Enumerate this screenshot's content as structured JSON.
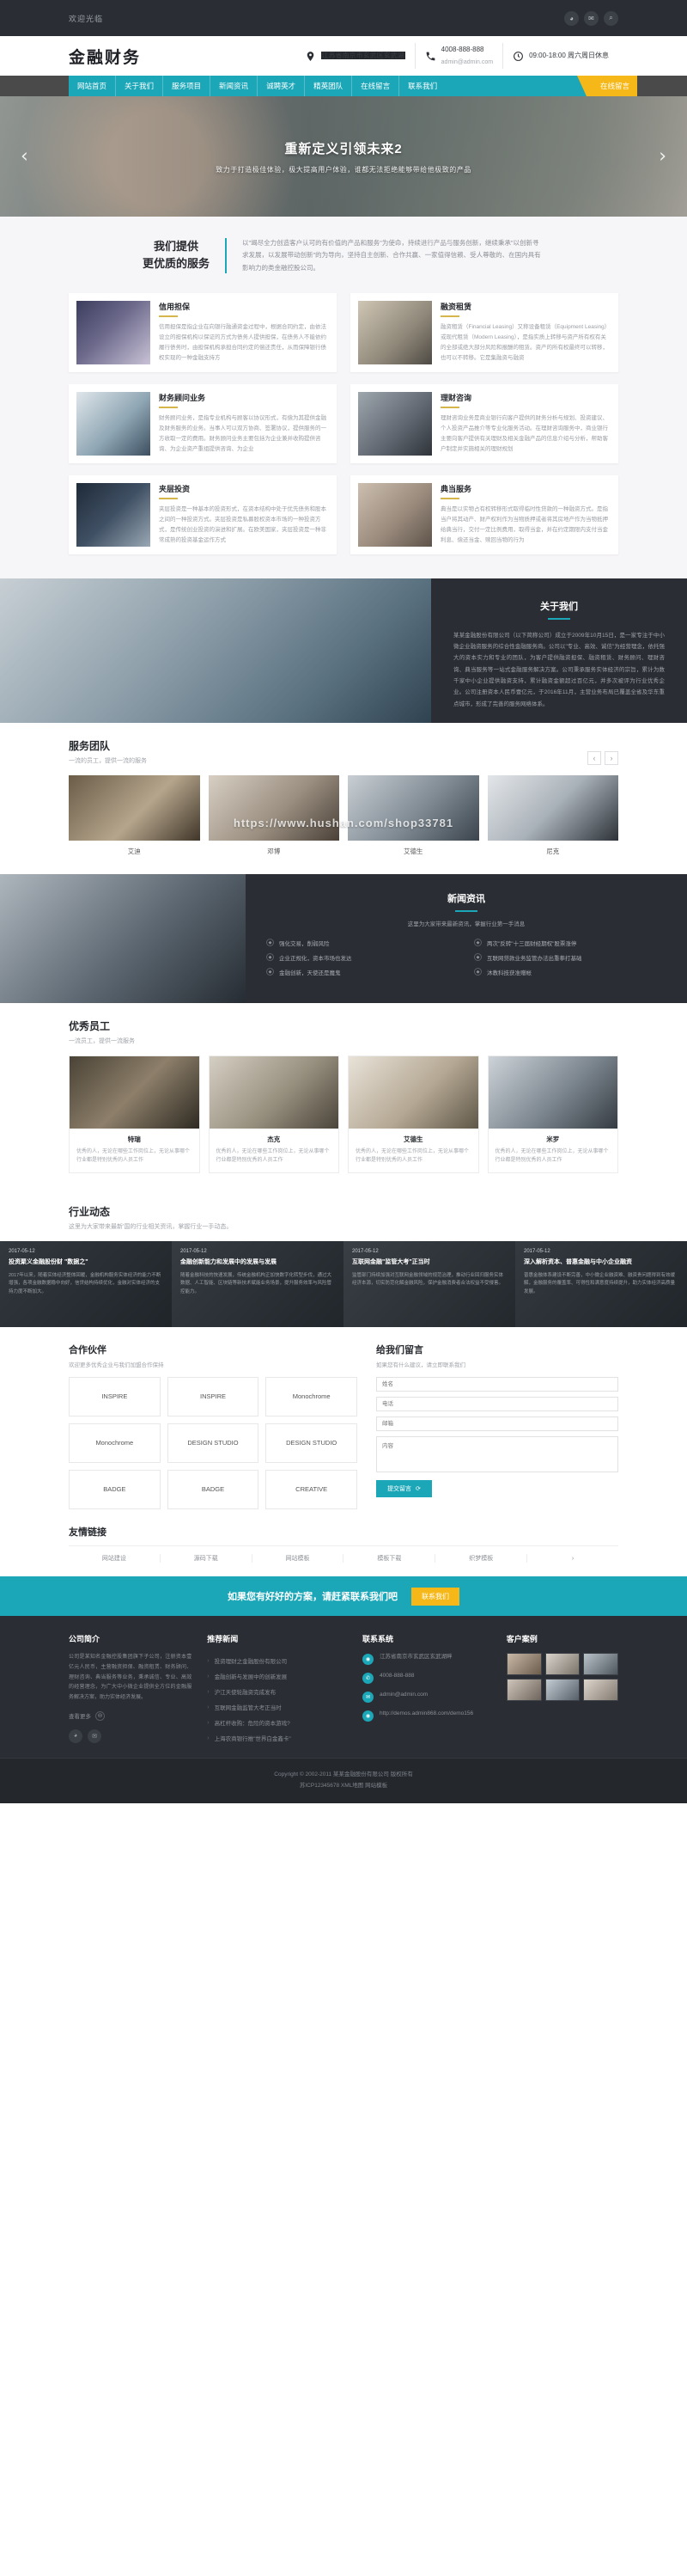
{
  "topbar": {
    "welcome": "欢迎光临",
    "social": [
      {
        "name": "weibo-icon",
        "glyph": "◕"
      },
      {
        "name": "wechat-icon",
        "glyph": "✉"
      },
      {
        "name": "search-icon",
        "glyph": "⌕"
      }
    ]
  },
  "header": {
    "logo": "金融财务",
    "info": [
      {
        "icon": "location-icon",
        "line1": "江苏省南京市玄武区玄武湖",
        "line1_hl": "江苏省南京市玄武区玄",
        "line1_rest": "武湖",
        "line2": ""
      },
      {
        "icon": "phone-icon",
        "line1": "4008-888-888",
        "line2": "admin@admin.com"
      },
      {
        "icon": "clock-icon",
        "line1": "09:00-18:00 周六周日休息",
        "line2": ""
      }
    ]
  },
  "nav": {
    "items": [
      "网站首页",
      "关于我们",
      "服务项目",
      "新闻资讯",
      "诚聘英才",
      "精英团队",
      "在线留言",
      "联系我们"
    ],
    "cta": "在线留言"
  },
  "banner": {
    "title": "重新定义引领未来2",
    "subtitle": "致力于打造极佳体验，极大提高用户体验，谁都无法拒绝能够带给他极致的产品",
    "prev": "‹",
    "next": "›"
  },
  "services": {
    "title_line1": "我们提供",
    "title_line2": "更优质的服务",
    "desc": "以\"竭尽全力创造客户认可的有价值的产品和服务\"为使命，持续进行产品与服务创新，继续秉承\"以创新寻求发展，以发展带动创新\"的为导向，坚持自主创新、合作共赢、一家值得信赖、受人尊敬的、在国内具有影响力的类金融控股公司。",
    "cards": [
      {
        "title": "信用担保",
        "text": "信用担保是指企业在向银行融通资金过程中，根据合同约定，由依法设立的担保机构以保证的方式为债务人提供担保，在债务人不能依约履行债务时，由担保机构承担合同约定的偿还责任，从而保障银行债权实现的一种金融支持方"
      },
      {
        "title": "融资租赁",
        "text": "融资租赁（Financial Leasing）又称设备租赁（Equipment Leasing）或现代租赁（Modern Leasing），是指实质上转移与资产所有权有关的全部或绝大部分风险和报酬的租赁。资产的所有权最终可以转移，也可以不转移。它是集融资与融资"
      },
      {
        "title": "财务顾问业务",
        "text": "财务顾问业务，是指专业机构与顾客以协议形式，有偿为其提供金融及财务服务的业务。当事人可以双方协商、签署协议，提供服务的一方收取一定的费用。财务顾问业务主要包括为企业兼并收购提供咨询、为企业资产重组提供咨询、为企业"
      },
      {
        "title": "理财咨询",
        "text": "理财咨询业务是商业银行向客户提供的财务分析与规划、投资建议、个人投资产品推介等专业化服务活动。在理财咨询服务中，商业银行主要向客户提供有关理财及相关金融产品的信息介绍与分析，帮助客户制定并实施相关的理财规划"
      },
      {
        "title": "夹层投资",
        "text": "夹层投资是一种基本的投资形式，在资本结构中处于优先债务和股本之间的一种投资方式。夹层投资是私募股权资本市场的一种投资方式，是传统创业投资的演进和扩展。在欧美国家，夹层投资是一种非常成熟的投资基金运作方式"
      },
      {
        "title": "典当服务",
        "text": "典当是以实物占有权转移形式取得临时性贷款的一种融资方式。是指当户将其动产、财产权利作为当物质押或者将其房地产作为当物抵押给典当行，交付一定比例费用，取得当金，并在约定期限内支付当金利息、偿还当金、赎回当物的行为"
      }
    ]
  },
  "about": {
    "title": "关于我们",
    "text": "某某金融股份有限公司（以下简称公司）成立于2009年10月15日，是一家专注于中小微企业融资服务的综合性金融服务商。公司以\"专业、高效、诚信\"为经营理念，依托强大的资本实力和专业的团队，为客户提供融资担保、融资租赁、财务顾问、理财咨询、典当服务等一站式金融服务解决方案。公司秉承服务实体经济的宗旨，累计为数千家中小企业提供融资支持，累计融资金额超过百亿元，并多次被评为行业优秀企业。公司注册资本人民币壹亿元，于2016年11月，主营业务布局已覆盖全省及华东重点城市，形成了完善的服务网络体系。"
  },
  "team": {
    "title": "服务团队",
    "subtitle": "一流的员工，提供一流的服务",
    "prev": "‹",
    "next": "›",
    "members": [
      {
        "name": "艾迪"
      },
      {
        "name": "邓博"
      },
      {
        "name": "艾德生"
      },
      {
        "name": "尼克"
      }
    ],
    "watermark": "https://www.hushan.com/shop33781"
  },
  "news": {
    "title": "新闻资讯",
    "subtitle": "这里为大家带来最新资讯，掌握行业第一手消息",
    "items": [
      "强化交易，削弱风险",
      "两次\"反转\"十三届财经期权\"股票涨停",
      "企业正规化，资本市场也发达",
      "互联网贷款业务监管办法出重拳打基础",
      "金融创新，天使还是魔鬼",
      "沐教科技获准赠帐"
    ]
  },
  "staff": {
    "title": "优秀员工",
    "subtitle": "一流员工，提供一流服务",
    "members": [
      {
        "name": "特瑞",
        "desc": "优秀的人，无论在哪些工作岗位上，无论从事哪个行业都是特别优秀的人员工作"
      },
      {
        "name": "杰克",
        "desc": "优秀的人，无论在哪些工作岗位上，无论从事哪个行业都是特别优秀的人员工作"
      },
      {
        "name": "艾德生",
        "desc": "优秀的人，无论在哪些工作岗位上，无论从事哪个行业都是特别优秀的人员工作"
      },
      {
        "name": "米罗",
        "desc": "优秀的人，无论在哪些工作岗位上，无论从事哪个行业都是特别优秀的人员工作"
      }
    ]
  },
  "industry": {
    "title": "行业动态",
    "subtitle": "这里为大家带来最新'国的行业相关资讯，掌握行业一手动态。",
    "items": [
      {
        "date": "2017-05-12",
        "title": "投资聚义金融股份财 \"数据之\"",
        "text": "2017年以来，随着实体经济整体回暖，金融机构服务实体经济的能力不断增强，各项金融数据稳中向好，信贷结构持续优化，金融对实体经济的支持力度不断加大。"
      },
      {
        "date": "2017-05-12",
        "title": "金融创新能力和发展中的发展与发展",
        "text": "随着金融科技的快速发展，传统金融机构正加快数字化转型步伐，通过大数据、人工智能、区块链等新技术赋能业务场景，提升服务效率与风险管控能力。"
      },
      {
        "date": "2017-05-12",
        "title": "互联网金融\"监管大考\"正当时",
        "text": "监管部门持续加强对互联网金融领域的规范治理，推动行业回归服务实体经济本源，切实防范化解金融风险，保护金融消费者合法权益不受侵害。"
      },
      {
        "date": "2017-05-12",
        "title": "深入解析资本、普惠金融与中小企业融资",
        "text": "普惠金融体系建设不断完善，中小微企业融资难、融资贵问题得到有效缓解，金融服务的覆盖率、可得性和满意度持续提升，助力实体经济高质量发展。"
      }
    ]
  },
  "partners": {
    "title": "合作伙伴",
    "subtitle": "欢迎更多优秀企业与我们加盟合作保持",
    "items": [
      "INSPIRE",
      "INSPIRE",
      "Monochrome",
      "Monochrome",
      "DESIGN STUDIO",
      "DESIGN STUDIO",
      "BADGE",
      "BADGE",
      "CREATIVE"
    ]
  },
  "message": {
    "title": "给我们留言",
    "subtitle": "如果您有什么建议，请立即联系我们",
    "fields": [
      {
        "name": "name-field",
        "placeholder": "姓名"
      },
      {
        "name": "phone-field",
        "placeholder": "电话"
      },
      {
        "name": "email-field",
        "placeholder": "邮箱"
      },
      {
        "name": "content-field",
        "placeholder": "内容"
      }
    ],
    "submit": "提交留言",
    "reset_icon": "⟳"
  },
  "friendlinks": {
    "title": "友情链接",
    "items": [
      "网站建设",
      "源码下载",
      "网站模板",
      "模板下载",
      "织梦模板",
      "›"
    ]
  },
  "cta": {
    "text": "如果您有好好的方案，请赶紧联系我们吧",
    "button": "联系我们"
  },
  "footer": {
    "col1": {
      "title": "公司简介",
      "text": "公司是某知名金融控股集团旗下子公司，注册资本壹亿元人民币，主营融资担保、融资租赁、财务顾问、理财咨询、典当服务等业务，秉承诚信、专业、高效的经营理念，为广大中小微企业提供全方位的金融服务解决方案，助力实体经济发展。",
      "more": "查看更多",
      "more_icon": "⊖",
      "social": [
        {
          "name": "weibo-icon",
          "glyph": "◕"
        },
        {
          "name": "wechat-icon",
          "glyph": "✉"
        }
      ]
    },
    "col2": {
      "title": "推荐新闻",
      "items": [
        "投资理财之金融股份有限公司",
        "金融创新与发展中的创新发展",
        "沪江天使轮融资完成发布",
        "互联网金融监管大考正当时",
        "高杠杆收购：危险的资本游戏?",
        "上海农商银行推\"世界白金鑫卡\""
      ]
    },
    "col3": {
      "title": "联系系统",
      "items": [
        {
          "icon": "location-icon",
          "text": "江苏省南京市玄武区玄武湖畔"
        },
        {
          "icon": "phone-icon",
          "text": "4008-888-888"
        },
        {
          "icon": "mail-icon",
          "text": "admin@admin.com"
        },
        {
          "icon": "link-icon",
          "text": "http://demos.admin868.com/demo156"
        }
      ]
    },
    "col4": {
      "title": "客户案例",
      "cases": 6
    }
  },
  "copyright": {
    "line1": "Copyright © 2002-2011 某某金融股份有限公司 版权所有",
    "line2": "苏ICP12345678 XML地图 网站模板"
  }
}
